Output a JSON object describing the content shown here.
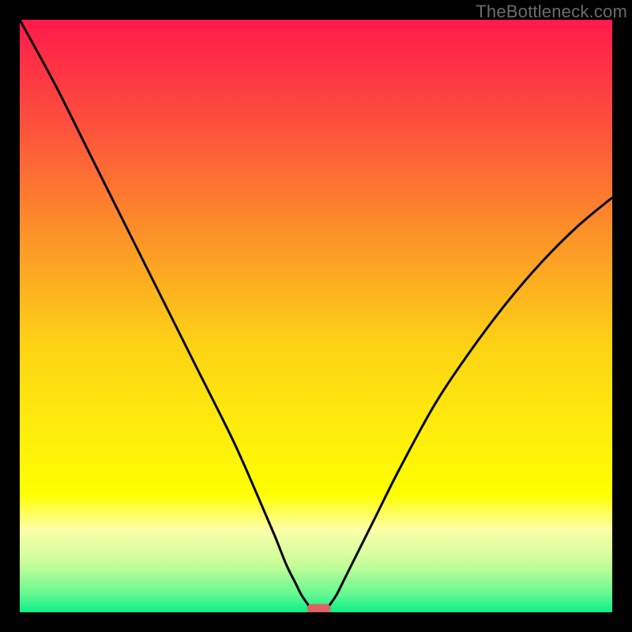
{
  "watermark": "TheBottleneck.com",
  "chart_data": {
    "type": "line",
    "title": "",
    "xlabel": "",
    "ylabel": "",
    "xlim": [
      0,
      100
    ],
    "ylim": [
      0,
      100
    ],
    "series": [
      {
        "name": "left-curve",
        "x": [
          0,
          6,
          12,
          18,
          24,
          30,
          36,
          40,
          43,
          45,
          46.5,
          47.5,
          48.5,
          49
        ],
        "y": [
          100,
          89,
          77,
          65,
          53,
          41,
          29,
          20,
          13,
          8,
          5,
          3,
          1.5,
          0.8
        ]
      },
      {
        "name": "right-curve",
        "x": [
          52,
          52.5,
          53.5,
          55,
          57,
          60,
          64,
          70,
          76,
          82,
          88,
          94,
          100
        ],
        "y": [
          0.8,
          1.5,
          3,
          6,
          10,
          16,
          24,
          35,
          44,
          52,
          59,
          65,
          70
        ]
      }
    ],
    "marker": {
      "name": "optimal-region",
      "x_center": 50.5,
      "width": 4,
      "y": 0.6,
      "color": "#de6464"
    },
    "gradient_stops": [
      {
        "offset": 0.0,
        "color": "#fe1a4b"
      },
      {
        "offset": 0.18,
        "color": "#fd513c"
      },
      {
        "offset": 0.38,
        "color": "#fd9827"
      },
      {
        "offset": 0.55,
        "color": "#fdd315"
      },
      {
        "offset": 0.7,
        "color": "#feee0b"
      },
      {
        "offset": 0.8,
        "color": "#ffff00"
      },
      {
        "offset": 0.86,
        "color": "#fdffa8"
      },
      {
        "offset": 0.92,
        "color": "#c5fd99"
      },
      {
        "offset": 0.97,
        "color": "#63f891"
      },
      {
        "offset": 1.0,
        "color": "#09f187"
      }
    ]
  }
}
